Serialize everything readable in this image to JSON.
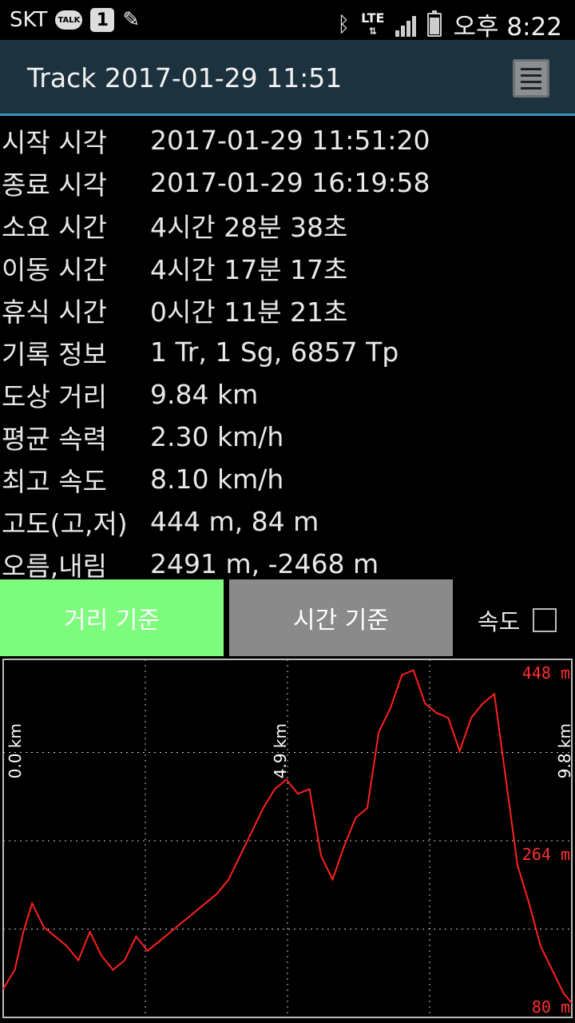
{
  "status_bar": {
    "carrier": "SKT",
    "talk": "TALK",
    "badge": "1",
    "lte": "LTE",
    "time": "오후 8:22",
    "icons": [
      "kakaotalk-icon",
      "one-badge-icon",
      "pencil-icon",
      "bluetooth-icon",
      "lte-icon",
      "signal-icon",
      "battery-icon"
    ]
  },
  "appbar": {
    "title": "Track 2017-01-29 11:51"
  },
  "info": [
    {
      "label": "시작 시각",
      "value": "2017-01-29 11:51:20"
    },
    {
      "label": "종료 시각",
      "value": "2017-01-29 16:19:58"
    },
    {
      "label": "소요 시간",
      "value": "4시간 28분 38초"
    },
    {
      "label": "이동 시간",
      "value": "4시간 17분 17초"
    },
    {
      "label": "휴식 시간",
      "value": "0시간 11분 21초"
    },
    {
      "label": "기록 정보",
      "value": "1 Tr, 1 Sg, 6857 Tp"
    },
    {
      "label": "도상 거리",
      "value": "9.84 km"
    },
    {
      "label": "평균 속력",
      "value": "2.30 km/h"
    },
    {
      "label": "최고 속도",
      "value": "8.10 km/h"
    },
    {
      "label": "고도(고,저)",
      "value": "444 m, 84 m"
    },
    {
      "label": "오름,내림",
      "value": "2491 m, -2468 m"
    }
  ],
  "buttons": {
    "distance": "거리 기준",
    "time": "시간 기준",
    "speed": "속도"
  },
  "chart_data": {
    "type": "line",
    "x_ticks": [
      "0.0 km",
      "4.9 km",
      "9.8 km"
    ],
    "y_ticks": [
      "448 m",
      "264 m",
      "80 m"
    ],
    "xlim": [
      0,
      9.84
    ],
    "ylim": [
      80,
      448
    ],
    "line_color": "#ff2020",
    "grid": true,
    "x": [
      0,
      0.2,
      0.35,
      0.5,
      0.7,
      0.9,
      1.1,
      1.3,
      1.5,
      1.7,
      1.9,
      2.1,
      2.3,
      2.5,
      2.7,
      2.9,
      3.1,
      3.3,
      3.5,
      3.7,
      3.9,
      4.1,
      4.3,
      4.5,
      4.7,
      4.9,
      5.1,
      5.3,
      5.5,
      5.7,
      5.9,
      6.1,
      6.3,
      6.5,
      6.7,
      6.9,
      7.1,
      7.3,
      7.5,
      7.7,
      7.9,
      8.1,
      8.3,
      8.5,
      8.7,
      8.9,
      9.1,
      9.3,
      9.5,
      9.7,
      9.84
    ],
    "y": [
      110,
      130,
      170,
      200,
      175,
      165,
      155,
      140,
      170,
      145,
      130,
      140,
      165,
      150,
      160,
      170,
      180,
      190,
      200,
      210,
      225,
      250,
      275,
      300,
      320,
      330,
      315,
      320,
      250,
      225,
      260,
      290,
      300,
      380,
      405,
      440,
      445,
      410,
      400,
      395,
      360,
      395,
      410,
      420,
      330,
      240,
      200,
      155,
      130,
      105,
      95
    ]
  }
}
